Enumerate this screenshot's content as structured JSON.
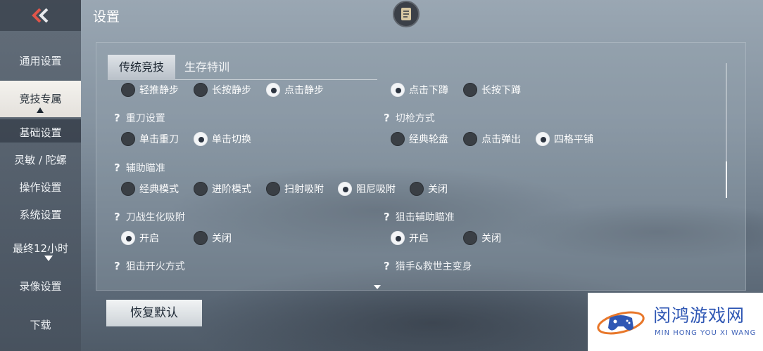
{
  "header": {
    "title": "设置"
  },
  "sidebar": {
    "items": [
      {
        "label": "通用设置"
      },
      {
        "label": "竞技专属"
      },
      {
        "label": "基础设置"
      },
      {
        "label": "灵敏 / 陀螺"
      },
      {
        "label": "操作设置"
      },
      {
        "label": "系统设置"
      },
      {
        "label": "最终12小时"
      },
      {
        "label": "录像设置"
      },
      {
        "label": "下载"
      }
    ]
  },
  "tabs": [
    {
      "label": "传统竞技",
      "active": true
    },
    {
      "label": "生存特训",
      "active": false
    }
  ],
  "options": {
    "crouch_left": [
      "轻推静步",
      "长按静步",
      "点击静步"
    ],
    "crouch_left_selected": "点击静步",
    "crouch_right": [
      "点击下蹲",
      "长按下蹲"
    ],
    "crouch_right_selected": "点击下蹲",
    "heavy_blade": {
      "title": "重刀设置",
      "opts": [
        "单击重刀",
        "单击切换"
      ],
      "selected": "单击切换"
    },
    "switch_gun": {
      "title": "切枪方式",
      "opts": [
        "经典轮盘",
        "点击弹出",
        "四格平铺"
      ],
      "selected": "四格平铺"
    },
    "aim_assist": {
      "title": "辅助瞄准",
      "opts": [
        "经典模式",
        "进阶模式",
        "扫射吸附",
        "阻尼吸附",
        "关闭"
      ],
      "selected": "阻尼吸附"
    },
    "blade_zombie": {
      "title": "刀战生化吸附",
      "opts": [
        "开启",
        "关闭"
      ],
      "selected": "开启"
    },
    "sniper_aim": {
      "title": "狙击辅助瞄准",
      "opts": [
        "开启",
        "关闭"
      ],
      "selected": "开启"
    },
    "sniper_fire": {
      "title": "狙击开火方式"
    },
    "hunter": {
      "title": "猎手&救世主变身"
    }
  },
  "footer": {
    "reset_label": "恢复默认"
  },
  "watermark": {
    "cn": "闵鸿游戏网",
    "en": "MIN HONG YOU XI WANG"
  },
  "colors": {
    "accent_red": "#e0554a",
    "watermark_blue": "#2f57b4"
  }
}
